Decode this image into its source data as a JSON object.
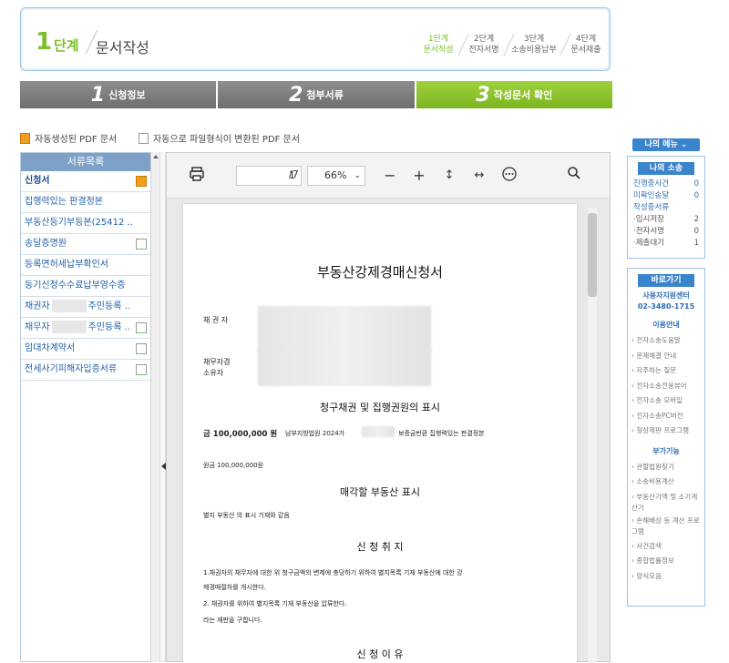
{
  "step_header": {
    "step_number": "1",
    "step_unit": "단계",
    "step_title": "문서작성",
    "mini_steps": [
      {
        "line1": "1단계",
        "line2": "문서작성"
      },
      {
        "line1": "2단계",
        "line2": "전자서명"
      },
      {
        "line1": "3단계",
        "line2": "소송비용납부"
      },
      {
        "line1": "4단계",
        "line2": "문서제출"
      }
    ]
  },
  "tabs": [
    {
      "num": "1",
      "label": "신청정보"
    },
    {
      "num": "2",
      "label": "첨부서류"
    },
    {
      "num": "3",
      "label": "작성문서 확인"
    }
  ],
  "legend": {
    "auto_pdf": "자동생성된 PDF 문서",
    "converted_pdf": "자동으로 파일형식이 변환된 PDF 문서"
  },
  "doc_list": {
    "header": "서류목록",
    "items": [
      {
        "label": "신청서",
        "badge": "auto"
      },
      {
        "label": "집행력있는 판결정본",
        "badge": ""
      },
      {
        "label": "부동산등기부등본(25412 ..",
        "badge": ""
      },
      {
        "label": "송달증명원",
        "badge": "converted"
      },
      {
        "label": "등록면허세납부확인서",
        "badge": ""
      },
      {
        "label": "등기신청수수료납부영수증",
        "badge": ""
      },
      {
        "label_prefix": "채권자",
        "label_suffix": "주민등록 ..",
        "badge": ""
      },
      {
        "label_prefix": "채무자",
        "label_suffix": "주민등록 ..",
        "badge": "converted"
      },
      {
        "label": "임대차계약서",
        "badge": "converted"
      },
      {
        "label": "전세사기피해자입증서류",
        "badge": "converted"
      }
    ]
  },
  "viewer": {
    "page_current": "1",
    "page_total": "/7",
    "zoom": "66%"
  },
  "pdf_page": {
    "title": "부동산강제경매신청서",
    "creditor_label": "채 권 자",
    "debtor_label_1": "채무자겸",
    "debtor_label_2": "소유자",
    "section1_title": "청구채권 및 집행권원의 표시",
    "claim_amount_label": "금 100,000,000 원",
    "claim_text_a": "남부지방법원 2024가",
    "claim_text_b": "보증금반환 집행력있는 판결정본",
    "principal": "원금 100,000,000원",
    "section2_title": "매각할 부동산 표시",
    "property_text": "별지 부동산 의 표시 기재와 같음",
    "section3_title": "신 청 취 지",
    "purpose_1": "1.채권자의 채무자에 대한 위 청구금액의 변제에 충당하기 위하여 별지목록 기재 부동산에 대한 강",
    "purpose_1b": "제경매절차를 개시한다.",
    "purpose_2": "2. 채권자를 위하여 별지목록 기재 부동산을 압류한다.",
    "purpose_3": "라는 재판을 구합니다.",
    "section4_title": "신 청 이 유"
  },
  "sidebar": {
    "my_menu": "나의 메뉴 ⌄",
    "my_case_head": "나의 소송",
    "case_rows": [
      {
        "label": "진행중사건",
        "value": "0",
        "style": "blue"
      },
      {
        "label": "미확인송달",
        "value": "0",
        "style": "blue"
      },
      {
        "label": "작성중서류",
        "value": "",
        "style": "blue"
      },
      {
        "label": "·임시저장",
        "value": "2",
        "style": "gray"
      },
      {
        "label": "·전자서명",
        "value": "0",
        "style": "gray"
      },
      {
        "label": "·제출대기",
        "value": "1",
        "style": "gray"
      }
    ],
    "shortcut_head": "바로가기",
    "support_center": "사용자지원센터",
    "support_phone": "02-3480-1715",
    "usage_guide": "이용안내",
    "guide_links": [
      "› 전자소송도움말",
      "› 문제해결 안내",
      "› 자주하는 질문",
      "› 전자소송전용뷰어",
      "› 전자소송 모바일",
      "› 전자소송PC버전",
      "› 형상제판 프로그램"
    ],
    "extra_head": "부가기능",
    "extra_links": [
      "› 관할법원찾기",
      "› 소송비용계산",
      "› 부동산가액 및 소가계산기",
      "› 손해배상 등 계산 프로그램",
      "› 사건검색",
      "› 종합법률정보",
      "› 양식모음"
    ]
  }
}
